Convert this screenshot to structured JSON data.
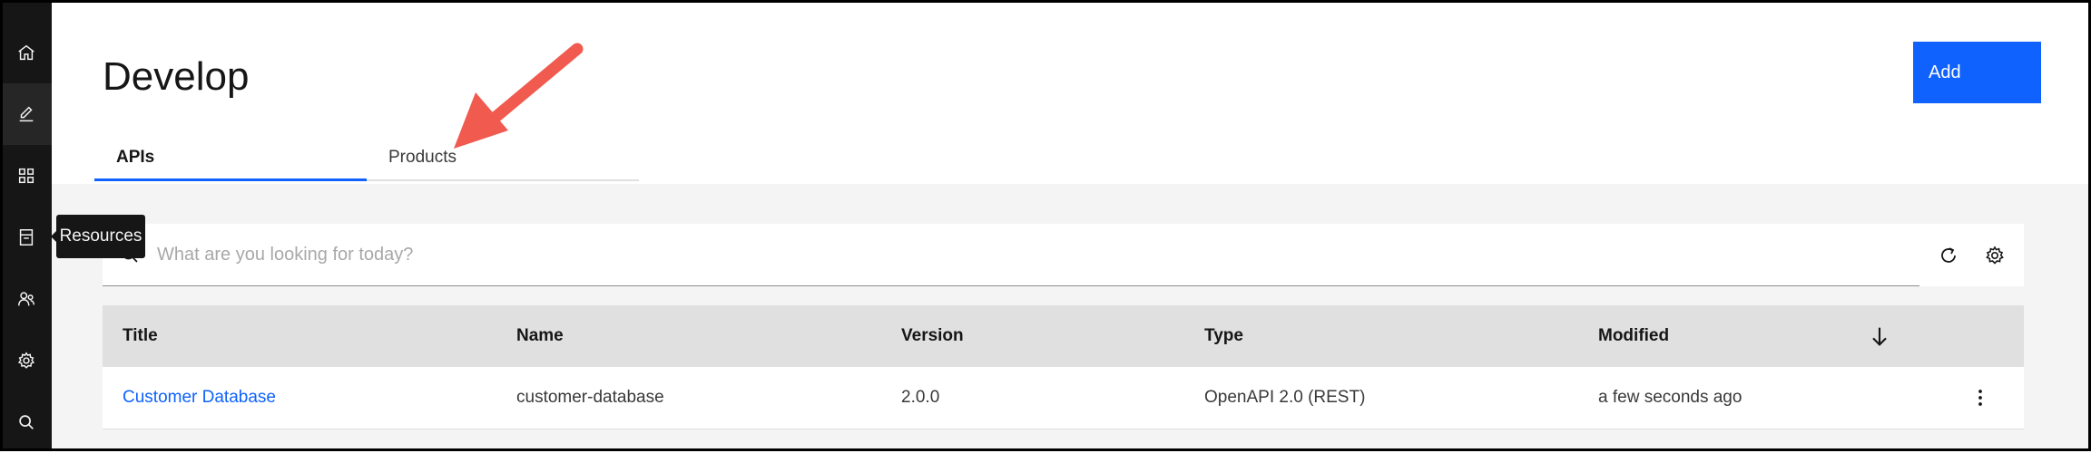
{
  "sidenav": {
    "items": [
      {
        "icon": "home-icon"
      },
      {
        "icon": "edit-icon"
      },
      {
        "icon": "apps-icon"
      },
      {
        "icon": "resources-icon"
      },
      {
        "icon": "users-icon"
      },
      {
        "icon": "settings-icon"
      },
      {
        "icon": "search-icon"
      }
    ],
    "active_index": 1
  },
  "tooltip": {
    "text": "Resources"
  },
  "header": {
    "title": "Develop",
    "add_button": "Add",
    "tabs": [
      {
        "label": "APIs",
        "selected": true
      },
      {
        "label": "Products",
        "selected": false
      }
    ]
  },
  "search": {
    "placeholder": "What are you looking for today?",
    "value": ""
  },
  "toolbar": {
    "refresh_icon": "refresh-icon",
    "settings_icon": "settings-icon"
  },
  "table": {
    "columns": [
      "Title",
      "Name",
      "Version",
      "Type",
      "Modified"
    ],
    "rows": [
      {
        "title": "Customer Database",
        "name": "customer-database",
        "version": "2.0.0",
        "type": "OpenAPI 2.0 (REST)",
        "modified": "a few seconds ago"
      }
    ]
  },
  "colors": {
    "accent": "#0f62fe",
    "sidenav_bg": "#161616",
    "annotation_arrow": "#f05a4f"
  }
}
